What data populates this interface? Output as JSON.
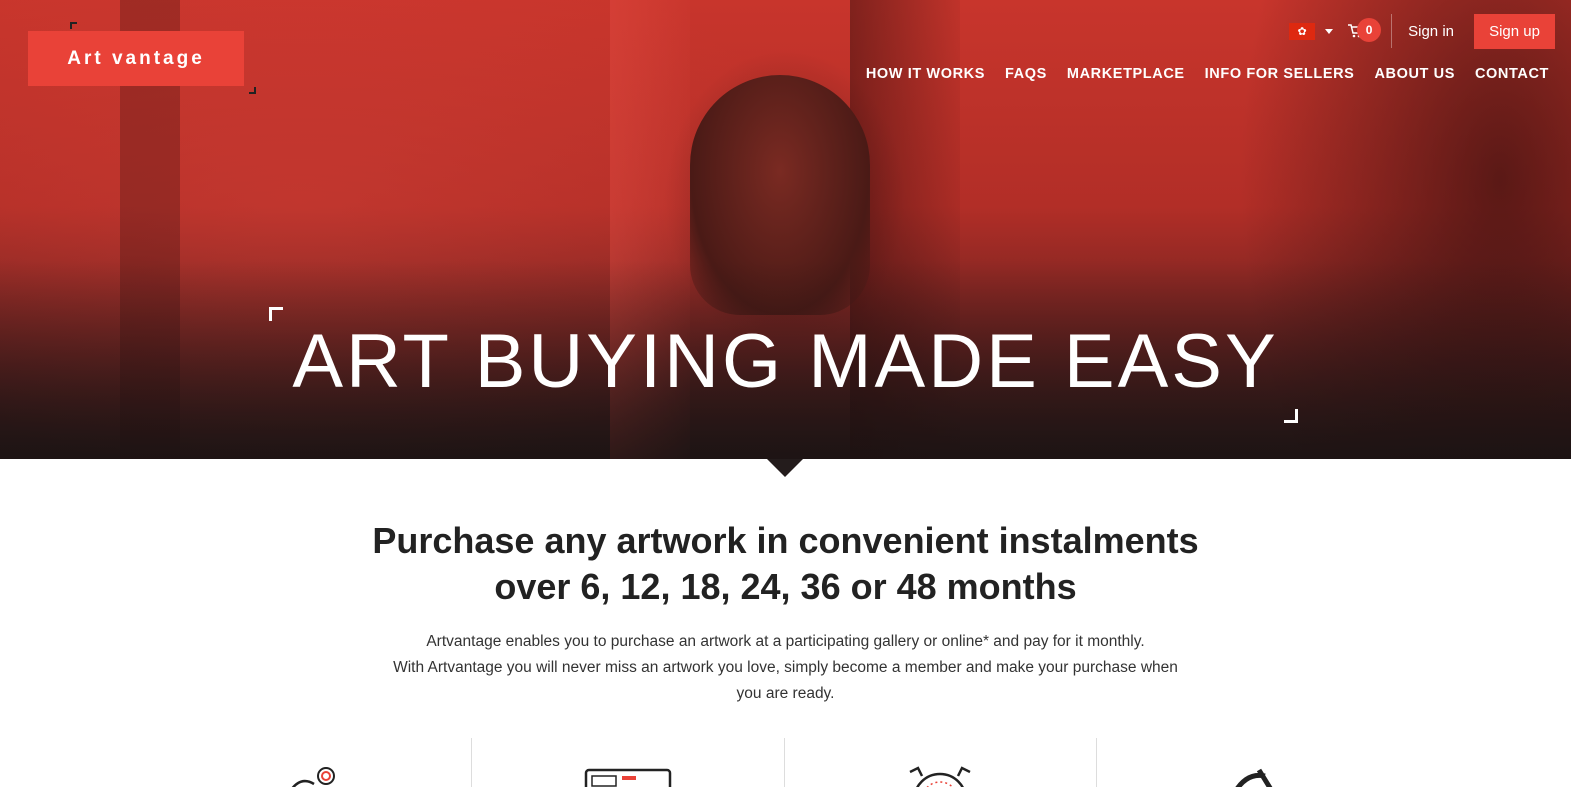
{
  "brand": {
    "name": "Art vantage",
    "accent": "#e94238"
  },
  "topbar": {
    "flag_icon": "hong-kong-flag-icon",
    "cart_count": "0",
    "signin_label": "Sign in",
    "signup_label": "Sign up"
  },
  "nav": {
    "items": [
      {
        "label": "HOW IT WORKS"
      },
      {
        "label": "FAQS"
      },
      {
        "label": "MARKETPLACE"
      },
      {
        "label": "INFO FOR SELLERS"
      },
      {
        "label": "ABOUT US"
      },
      {
        "label": "CONTACT"
      }
    ]
  },
  "hero": {
    "title": "ART BUYING MADE EASY"
  },
  "intro": {
    "heading_line1": "Purchase any artwork in convenient instalments",
    "heading_line2": "over 6, 12, 18, 24, 36 or 48 months",
    "para_line1": "Artvantage enables you to purchase an artwork at a participating gallery or online* and pay for it monthly.",
    "para_line2": "With Artvantage you will never miss an artwork you love, simply become a member and make your purchase when",
    "para_line3": "you are ready."
  },
  "features": [
    {
      "icon": "location-pin-icon"
    },
    {
      "icon": "laptop-icon"
    },
    {
      "icon": "stopwatch-icon"
    },
    {
      "icon": "percent-icon"
    }
  ]
}
